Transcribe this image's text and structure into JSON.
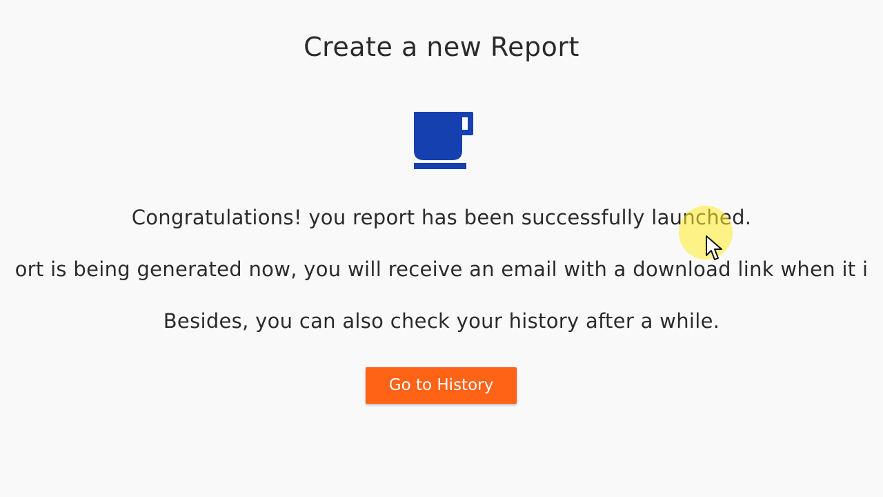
{
  "page": {
    "title": "Create a new Report"
  },
  "icons": {
    "status": "coffee-cup-icon",
    "pointer": "mouse-pointer-icon"
  },
  "message": {
    "line1": "Congratulations! you report has been successfully launched.",
    "line2": "ort is being generated now, you will receive an email with a download link when it i",
    "line3": "Besides, you can also check your history after a while."
  },
  "actions": {
    "history_label": "Go to History"
  },
  "colors": {
    "icon": "#1540b0",
    "button": "#ff6316",
    "highlight": "#ffec28"
  }
}
